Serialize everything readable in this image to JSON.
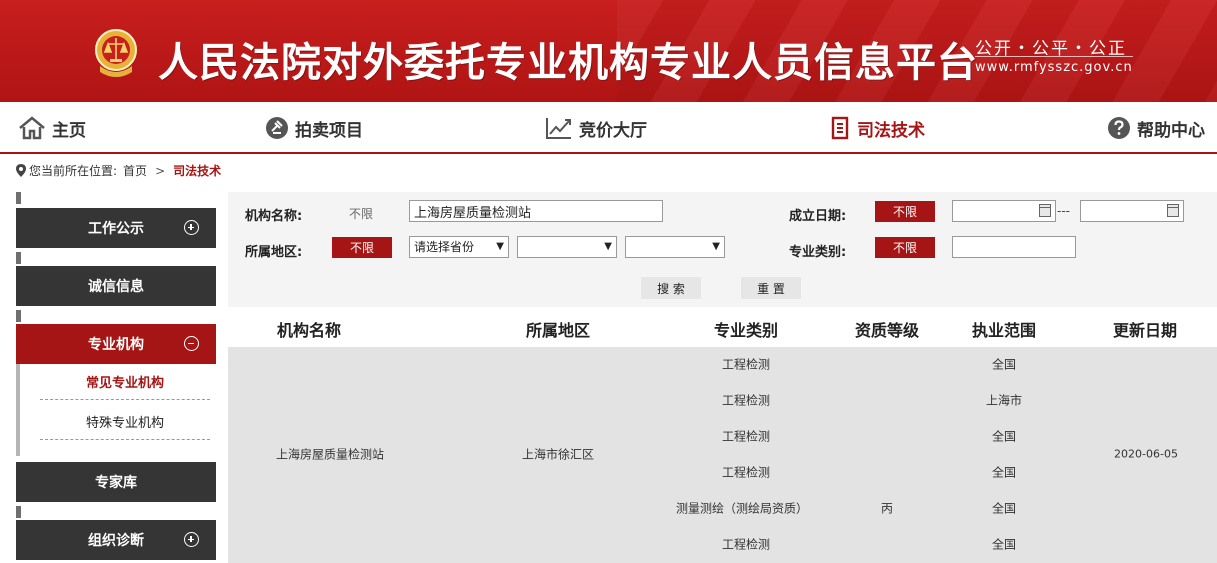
{
  "header": {
    "title": "人民法院对外委托专业机构专业人员信息平台",
    "slogan": "公开・公平・公正",
    "url": "www.rmfysszc.gov.cn",
    "brand_color": "#b81818"
  },
  "nav": {
    "items": [
      {
        "label": "主页",
        "icon": "home-icon"
      },
      {
        "label": "拍卖项目",
        "icon": "gavel-icon"
      },
      {
        "label": "竞价大厅",
        "icon": "trend-chart-icon"
      },
      {
        "label": "司法技术",
        "icon": "document-icon",
        "active": true
      },
      {
        "label": "帮助中心",
        "icon": "question-icon"
      }
    ]
  },
  "breadcrumb": {
    "prefix": "您当前所在位置:",
    "home": "首页",
    "separator": ">",
    "current": "司法技术"
  },
  "sidebar": {
    "items": [
      {
        "label": "工作公示",
        "toggle": "plus"
      },
      {
        "label": "诚信信息"
      },
      {
        "label": "专业机构",
        "toggle": "minus",
        "active": true
      },
      {
        "label": "专家库"
      },
      {
        "label": "组织诊断",
        "toggle": "plus"
      }
    ],
    "subitems": [
      {
        "label": "常见专业机构",
        "active": true
      },
      {
        "label": "特殊专业机构"
      }
    ]
  },
  "filter": {
    "org_name_label": "机构名称:",
    "org_name_unlimited": "不限",
    "org_name_value": "上海房屋质量检测站",
    "founded_label": "成立日期:",
    "founded_unlimited": "不限",
    "founded_from": "",
    "founded_to": "",
    "founded_sep": "---",
    "region_label": "所属地区:",
    "region_unlimited": "不限",
    "province_selected": "请选择省份",
    "city_selected": "",
    "district_selected": "",
    "category_label": "专业类别:",
    "category_unlimited": "不限",
    "category_value": "",
    "search_label": "搜 索",
    "reset_label": "重 置"
  },
  "table": {
    "headers": [
      "机构名称",
      "所属地区",
      "专业类别",
      "资质等级",
      "执业范围",
      "更新日期"
    ],
    "row": {
      "name": "上海房屋质量检测站",
      "region": "上海市徐汇区",
      "update_date": "2020-06-05",
      "sub_rows": [
        {
          "category": "工程检测",
          "level": "",
          "scope": "全国"
        },
        {
          "category": "工程检测",
          "level": "",
          "scope": "上海市"
        },
        {
          "category": "工程检测",
          "level": "",
          "scope": "全国"
        },
        {
          "category": "工程检测",
          "level": "",
          "scope": "全国"
        },
        {
          "category": "测量测绘（测绘局资质）",
          "level": "丙",
          "scope": "全国"
        },
        {
          "category": "工程检测",
          "level": "",
          "scope": "全国"
        }
      ]
    }
  }
}
